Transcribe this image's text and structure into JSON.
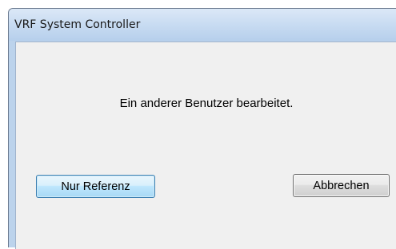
{
  "dialog": {
    "title": "VRF System Controller",
    "message": "Ein anderer Benutzer bearbeitet.",
    "buttons": {
      "reference_label": "Nur Referenz",
      "cancel_label": "Abbrechen"
    }
  }
}
